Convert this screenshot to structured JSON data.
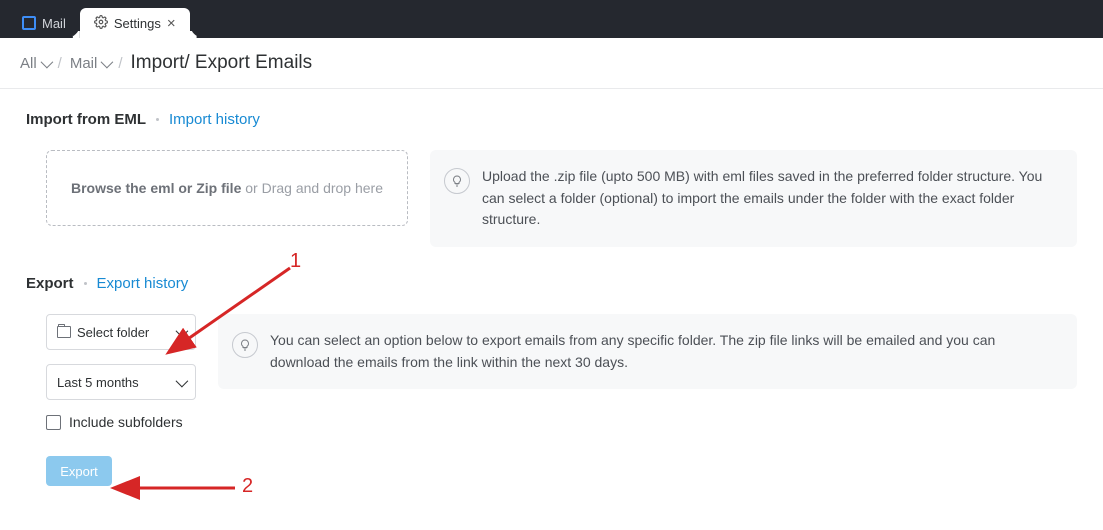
{
  "tabs": {
    "mail": "Mail",
    "settings": "Settings"
  },
  "breadcrumbs": {
    "all": "All",
    "mail": "Mail",
    "current": "Import/ Export Emails"
  },
  "import": {
    "title": "Import from EML",
    "history_link": "Import history",
    "drop_bold": "Browse the eml or Zip file",
    "drop_rest": " or Drag and drop here",
    "hint": "Upload the .zip file (upto 500 MB) with eml files saved in the preferred folder structure. You can select a folder (optional) to import the emails under the folder with the exact folder structure."
  },
  "export": {
    "title": "Export",
    "history_link": "Export history",
    "select_folder": "Select folder",
    "period": "Last 5 months",
    "include_sub": "Include subfolders",
    "button": "Export",
    "hint": "You can select an option below to export emails from any specific folder. The zip file links will be emailed and you can download the emails from the link within the next 30 days."
  },
  "annotations": {
    "one": "1",
    "two": "2"
  }
}
